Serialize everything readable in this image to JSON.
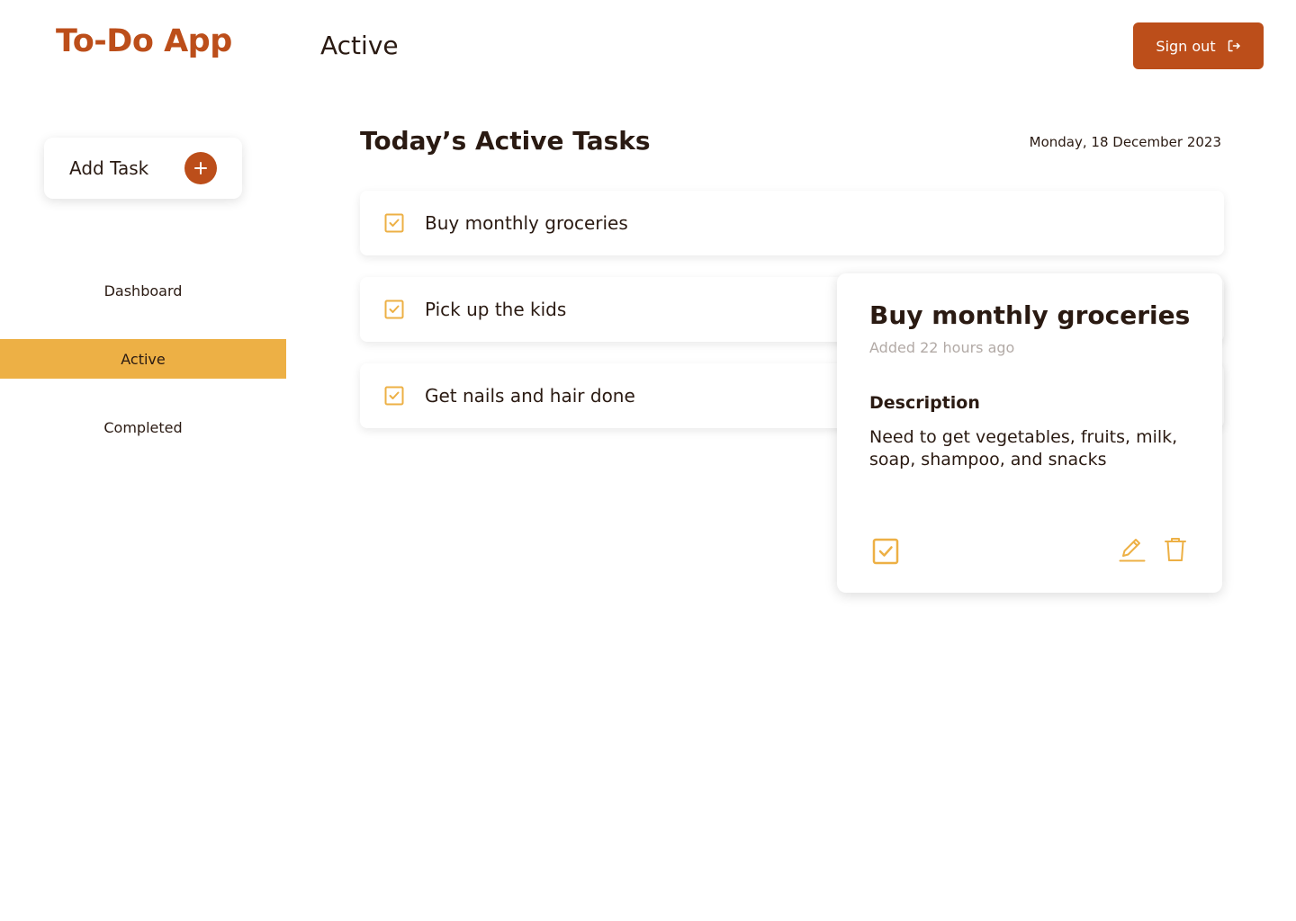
{
  "app": {
    "logo": "To-Do App",
    "page_title": "Active",
    "sign_out_label": "Sign out"
  },
  "sidebar": {
    "add_task_label": "Add Task",
    "items": [
      {
        "label": "Dashboard",
        "active": false
      },
      {
        "label": "Active",
        "active": true
      },
      {
        "label": "Completed",
        "active": false
      }
    ]
  },
  "main": {
    "section_title": "Today’s Active Tasks",
    "date": "Monday, 18 December 2023",
    "tasks": [
      {
        "title": "Buy monthly groceries"
      },
      {
        "title": "Pick up the kids"
      },
      {
        "title": "Get nails and hair done"
      }
    ]
  },
  "detail": {
    "title": "Buy monthly groceries",
    "added": "Added 22 hours ago",
    "description_label": "Description",
    "description": "Need to get vegetables, fruits, milk, soap, shampoo, and snacks"
  },
  "colors": {
    "brand": "#bc4e1a",
    "accent": "#edb045",
    "text": "#2a1a12",
    "muted": "#b2aaa6"
  },
  "icons": [
    "sign-out-icon",
    "plus-icon",
    "checkbox-icon",
    "pencil-icon",
    "trash-icon"
  ]
}
